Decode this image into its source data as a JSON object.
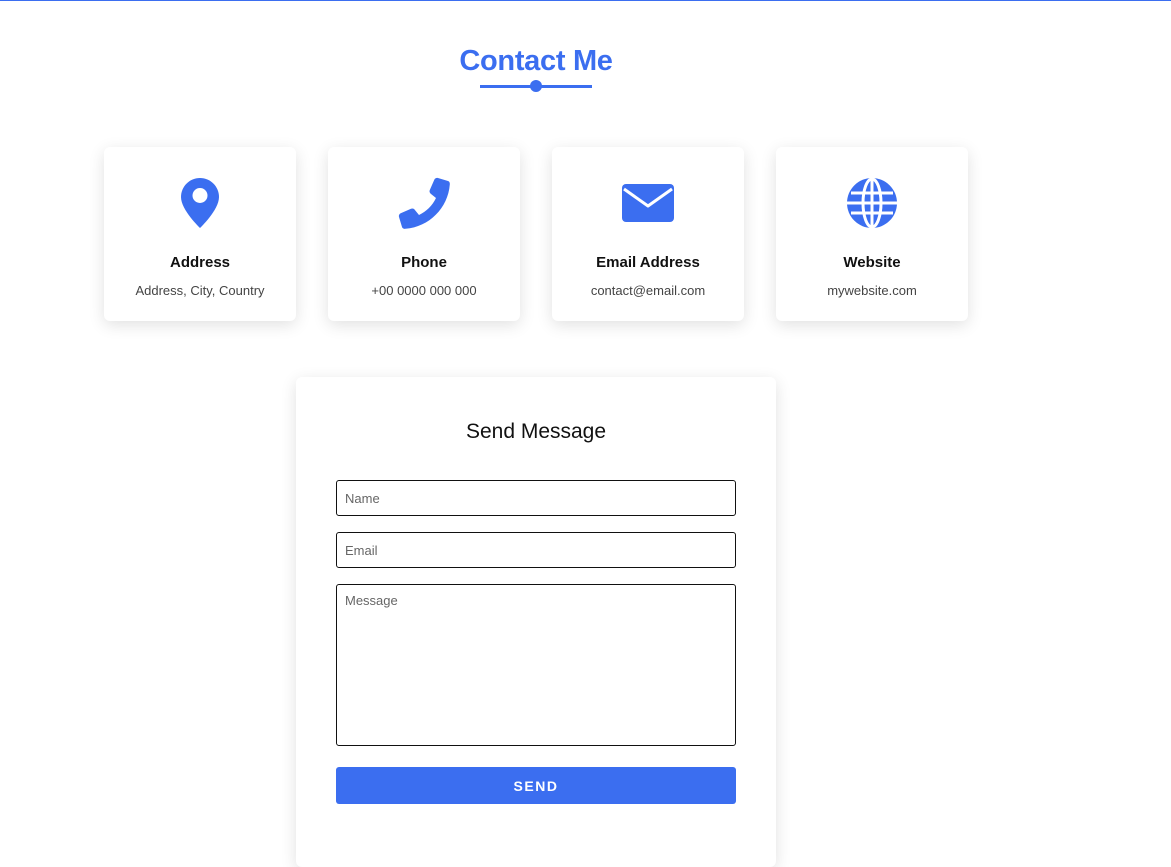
{
  "heading": "Contact Me",
  "colors": {
    "accent": "#3b6ef0",
    "text": "#111111",
    "muted": "#444444"
  },
  "cards": [
    {
      "icon": "map-pin-icon",
      "title": "Address",
      "value": "Address, City, Country"
    },
    {
      "icon": "phone-icon",
      "title": "Phone",
      "value": "+00 0000 000 000"
    },
    {
      "icon": "envelope-icon",
      "title": "Email Address",
      "value": "contact@email.com"
    },
    {
      "icon": "globe-icon",
      "title": "Website",
      "value": "mywebsite.com"
    }
  ],
  "form": {
    "title": "Send Message",
    "name_placeholder": "Name",
    "email_placeholder": "Email",
    "message_placeholder": "Message",
    "send_label": "SEND"
  }
}
